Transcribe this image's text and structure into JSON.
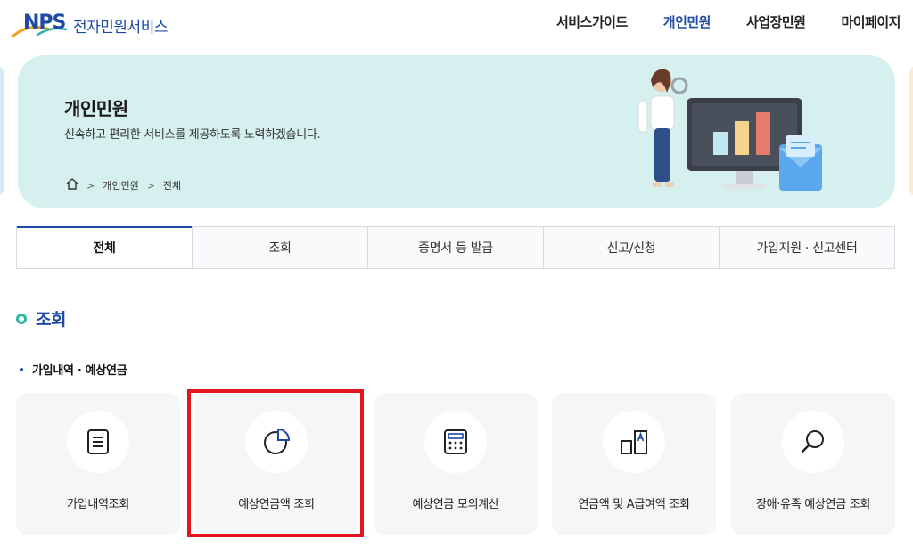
{
  "header": {
    "logo_mark": "NPS",
    "logo_text": "전자민원서비스",
    "nav": [
      "서비스가이드",
      "개인민원",
      "사업장민원",
      "마이페이지"
    ],
    "active_nav": 1
  },
  "hero": {
    "title": "개인민원",
    "subtitle": "신속하고 편리한 서비스를 제공하도록 노력하겠습니다.",
    "breadcrumb": [
      "개인민원",
      "전체"
    ]
  },
  "tabs": [
    "전체",
    "조회",
    "증명서 등 발급",
    "신고/신청",
    "가입지원 · 신고센터"
  ],
  "section": {
    "title": "조회",
    "subtitle": "가입내역 · 예상연금"
  },
  "cards": [
    {
      "label": "가입내역조회",
      "icon": "document-icon"
    },
    {
      "label": "예상연금액 조회",
      "icon": "pie-chart-icon"
    },
    {
      "label": "예상연금 모의계산",
      "icon": "calculator-icon"
    },
    {
      "label": "연금액 및 A급여액 조회",
      "icon": "compare-icon"
    },
    {
      "label": "장애·유족 예상연금 조회",
      "icon": "magnifier-icon"
    }
  ],
  "colors": {
    "brand": "#1f4aa3",
    "hero_bg": "#d5f0ee",
    "accent_ring": "#2db5a8",
    "highlight": "#e3161f"
  }
}
